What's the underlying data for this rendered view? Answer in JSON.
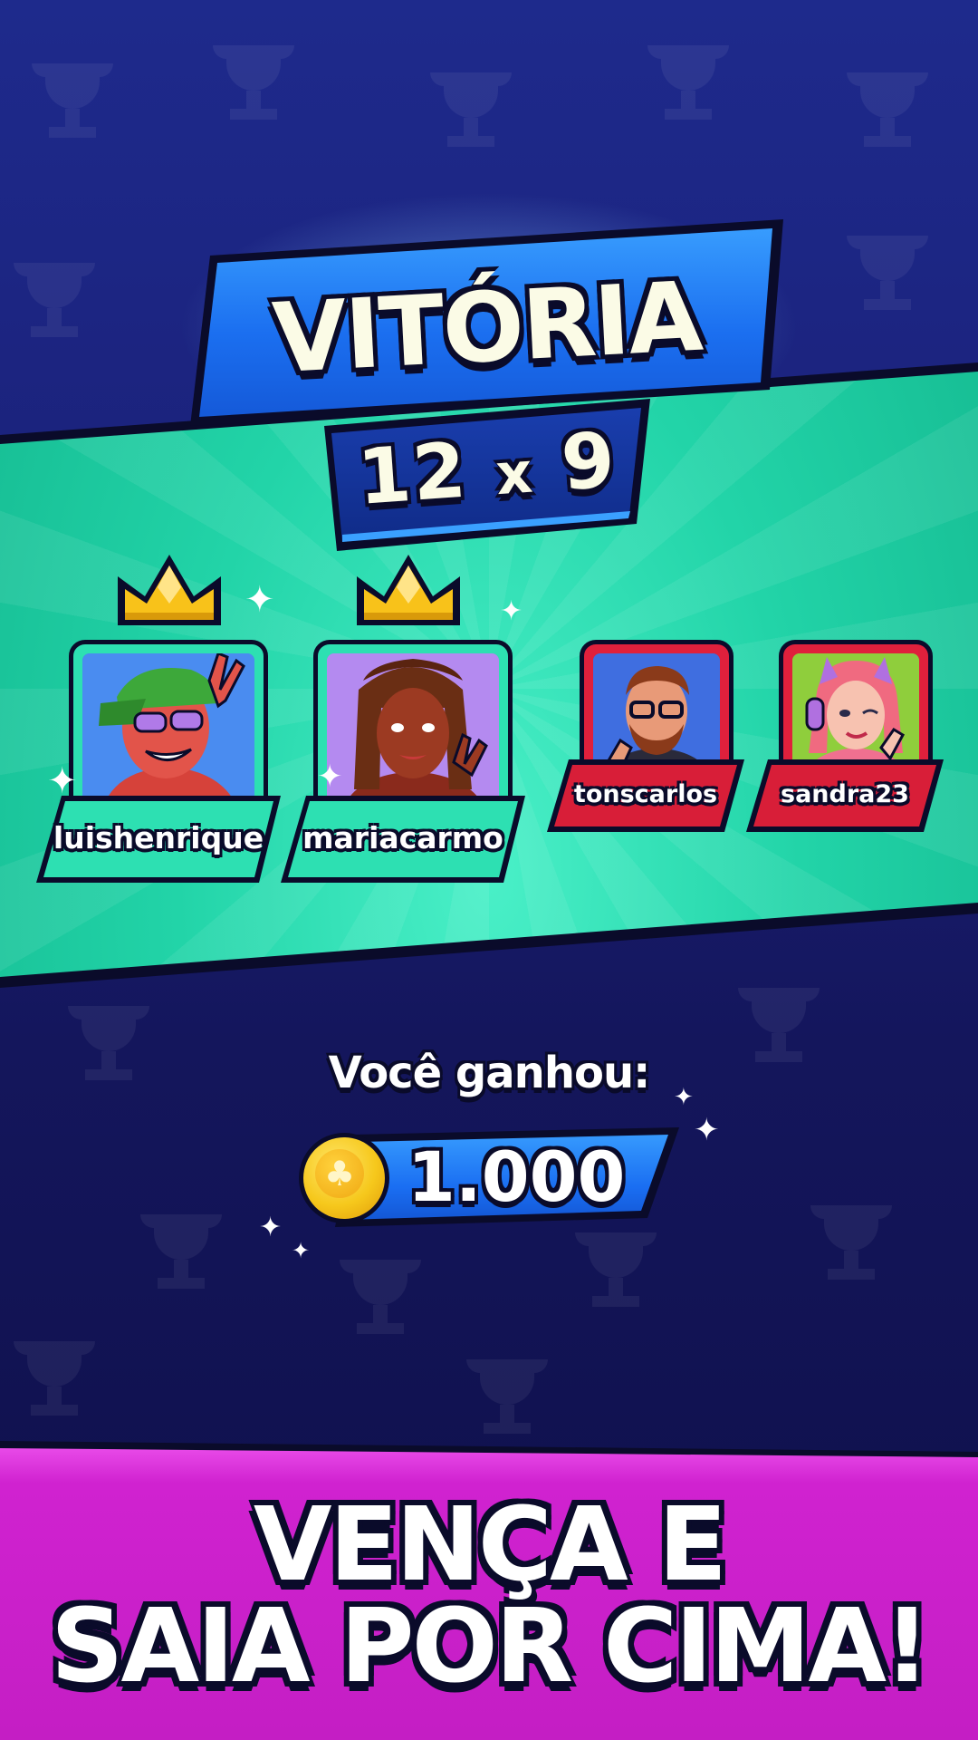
{
  "result": {
    "title": "VITÓRIA",
    "score_left": "12",
    "score_sep": "x",
    "score_right": "9"
  },
  "players": [
    {
      "name": "luishenrique",
      "winner": true,
      "avatar": "avatar-green-cap-sunglasses"
    },
    {
      "name": "mariacarmo",
      "winner": true,
      "avatar": "avatar-braids"
    },
    {
      "name": "tonscarlos",
      "winner": false,
      "avatar": "avatar-beard-glasses"
    },
    {
      "name": "sandra23",
      "winner": false,
      "avatar": "avatar-pink-hair-headphones"
    }
  ],
  "reward": {
    "label": "Você ganhou:",
    "amount": "1.000",
    "currency_icon": "club-coin-icon"
  },
  "slogan": {
    "line1": "VENÇA E",
    "line2": "SAIA POR CIMA!"
  },
  "colors": {
    "winner_frame": "#2de0b2",
    "loser_frame": "#e0203c",
    "banner_blue": "#1b6ff0",
    "promo_magenta": "#c41ec4"
  }
}
